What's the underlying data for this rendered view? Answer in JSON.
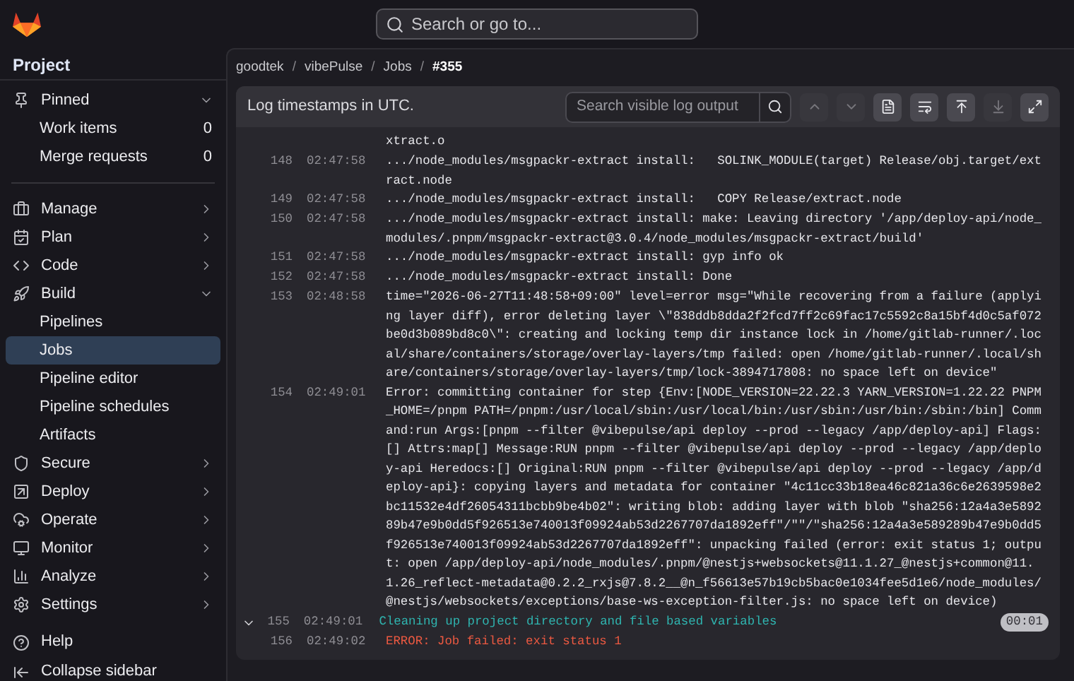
{
  "top_bar": {
    "search": {
      "placeholder": "Search or go to..."
    }
  },
  "sidebar": {
    "title": "Project",
    "pinned": {
      "label": "Pinned",
      "expanded": true,
      "items": [
        {
          "label": "Work items",
          "count": "0"
        },
        {
          "label": "Merge requests",
          "count": "0"
        }
      ]
    },
    "items": [
      {
        "label": "Manage",
        "expanded": false
      },
      {
        "label": "Plan",
        "expanded": false
      },
      {
        "label": "Code",
        "expanded": false
      },
      {
        "label": "Build",
        "expanded": true,
        "children": [
          {
            "label": "Pipelines",
            "selected": false
          },
          {
            "label": "Jobs",
            "selected": true
          },
          {
            "label": "Pipeline editor",
            "selected": false
          },
          {
            "label": "Pipeline schedules",
            "selected": false
          },
          {
            "label": "Artifacts",
            "selected": false
          }
        ]
      },
      {
        "label": "Secure",
        "expanded": false
      },
      {
        "label": "Deploy",
        "expanded": false
      },
      {
        "label": "Operate",
        "expanded": false
      },
      {
        "label": "Monitor",
        "expanded": false
      },
      {
        "label": "Analyze",
        "expanded": false
      },
      {
        "label": "Settings",
        "expanded": false
      }
    ],
    "footer": [
      {
        "label": "Help"
      },
      {
        "label": "Collapse sidebar"
      }
    ]
  },
  "breadcrumbs": [
    {
      "label": "goodtek"
    },
    {
      "separator": "/",
      "label": "vibePulse"
    },
    {
      "separator": "/",
      "label": "Jobs"
    },
    {
      "separator": "/",
      "label": "#355"
    }
  ],
  "log": {
    "notice": "Log timestamps in UTC.",
    "search": {
      "placeholder": "Search visible log output"
    },
    "toolbar": [
      {
        "disabled": true
      },
      {
        "disabled": true
      },
      {
        "disabled": false
      },
      {
        "disabled": false
      },
      {
        "disabled": false
      },
      {
        "disabled": true
      },
      {
        "disabled": false
      }
    ],
    "lines": [
      {
        "kind": "plain",
        "message": "xtract.o"
      },
      {
        "kind": "plain",
        "number": "148",
        "time": "02:47:58",
        "message": ".../node_modules/msgpackr-extract install:   SOLINK_MODULE(target) Release/obj.target/extract.node"
      },
      {
        "kind": "plain",
        "number": "149",
        "time": "02:47:58",
        "message": ".../node_modules/msgpackr-extract install:   COPY Release/extract.node"
      },
      {
        "kind": "plain",
        "number": "150",
        "time": "02:47:58",
        "message": ".../node_modules/msgpackr-extract install: make: Leaving directory '/app/deploy-api/node_modules/.pnpm/msgpackr-extract@3.0.4/node_modules/msgpackr-extract/build'"
      },
      {
        "kind": "plain",
        "number": "151",
        "time": "02:47:58",
        "message": ".../node_modules/msgpackr-extract install: gyp info ok"
      },
      {
        "kind": "plain",
        "number": "152",
        "time": "02:47:58",
        "message": ".../node_modules/msgpackr-extract install: Done"
      },
      {
        "kind": "plain",
        "number": "153",
        "time": "02:48:58",
        "message": "time=\"2026-06-27T11:48:58+09:00\" level=error msg=\"While recovering from a failure (applying layer diff), error deleting layer \\\"838ddb8dda2f2fcd7ff2c69fac17c5592c8a15bf4d0c5af072be0d3b089bd8c0\\\": creating and locking temp dir instance lock in /home/gitlab-runner/.local/share/containers/storage/overlay-layers/tmp failed: open /home/gitlab-runner/.local/share/containers/storage/overlay-layers/tmp/lock-3894717808: no space left on device\""
      },
      {
        "kind": "plain",
        "number": "154",
        "time": "02:49:01",
        "message": "Error: committing container for step {Env:[NODE_VERSION=22.22.3 YARN_VERSION=1.22.22 PNPM_HOME=/pnpm PATH=/pnpm:/usr/local/sbin:/usr/local/bin:/usr/sbin:/usr/bin:/sbin:/bin] Command:run Args:[pnpm --filter @vibepulse/api deploy --prod --legacy /app/deploy-api] Flags:[] Attrs:map[] Message:RUN pnpm --filter @vibepulse/api deploy --prod --legacy /app/deploy-api Heredocs:[] Original:RUN pnpm --filter @vibepulse/api deploy --prod --legacy /app/deploy-api}: copying layers and metadata for container \"4c11cc33b18ea46c821a36c6e2639598e2bc11532e4df26054311bcbb9be4b02\": writing blob: adding layer with blob \"sha256:12a4a3e589289b47e9b0dd5f926513e740013f09924ab53d2267707da1892eff\"/\"\"/\"sha256:12a4a3e589289b47e9b0dd5f926513e740013f09924ab53d2267707da1892eff\": unpacking failed (error: exit status 1; output: open /app/deploy-api/node_modules/.pnpm/@nestjs+websockets@11.1.27_@nestjs+common@11.1.26_reflect-metadata@0.2.2_rxjs@7.8.2__@n_f56613e57b19cb5bac0e1034fee5d1e6/node_modules/@nestjs/websockets/exceptions/base-ws-exception-filter.js: no space left on device)"
      },
      {
        "kind": "section",
        "expanded": true,
        "number": "155",
        "time": "02:49:01",
        "message": "Cleaning up project directory and file based variables",
        "duration": "00:01"
      },
      {
        "kind": "error",
        "number": "156",
        "time": "02:49:02",
        "message": "ERROR: Job failed: exit status 1"
      }
    ]
  }
}
